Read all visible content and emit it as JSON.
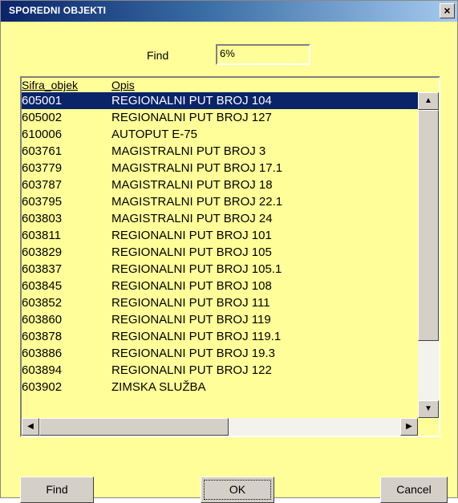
{
  "window": {
    "title": "SPOREDNI OBJEKTI",
    "close_label": "×"
  },
  "find": {
    "label": "Find",
    "value": "6%"
  },
  "list": {
    "columns": [
      "Sifra_objek",
      "Opis"
    ],
    "rows": [
      {
        "code": "605001",
        "desc": "REGIONALNI PUT BROJ 104",
        "selected": true
      },
      {
        "code": "605002",
        "desc": "REGIONALNI PUT BROJ 127"
      },
      {
        "code": "610006",
        "desc": "AUTOPUT E-75"
      },
      {
        "code": "603761",
        "desc": "MAGISTRALNI PUT BROJ  3"
      },
      {
        "code": "603779",
        "desc": "MAGISTRALNI PUT BROJ 17.1"
      },
      {
        "code": "603787",
        "desc": "MAGISTRALNI PUT BROJ 18"
      },
      {
        "code": "603795",
        "desc": "MAGISTRALNI PUT BROJ 22.1"
      },
      {
        "code": "603803",
        "desc": "MAGISTRALNI PUT BROJ 24"
      },
      {
        "code": "603811",
        "desc": "REGIONALNI PUT BROJ 101"
      },
      {
        "code": "603829",
        "desc": "REGIONALNI PUT BROJ 105"
      },
      {
        "code": "603837",
        "desc": "REGIONALNI PUT BROJ 105.1"
      },
      {
        "code": "603845",
        "desc": "REGIONALNI PUT BROJ 108"
      },
      {
        "code": "603852",
        "desc": "REGIONALNI PUT BROJ 111"
      },
      {
        "code": "603860",
        "desc": "REGIONALNI PUT BROJ 119"
      },
      {
        "code": "603878",
        "desc": "REGIONALNI PUT BROJ 119.1"
      },
      {
        "code": "603886",
        "desc": "REGIONALNI PUT BROJ 19.3"
      },
      {
        "code": "603894",
        "desc": "REGIONALNI PUT BROJ 122"
      },
      {
        "code": "603902",
        "desc": "ZIMSKA SLUŽBA"
      }
    ]
  },
  "buttons": {
    "find": "Find",
    "ok": "OK",
    "cancel": "Cancel"
  },
  "colors": {
    "background": "#fffe99",
    "selection": "#0a246a"
  },
  "icons": {
    "scroll_up": "up-arrow-icon",
    "scroll_down": "down-arrow-icon",
    "scroll_left": "left-arrow-icon",
    "scroll_right": "right-arrow-icon"
  }
}
